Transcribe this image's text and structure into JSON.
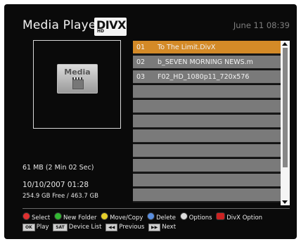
{
  "header": {
    "title": "Media Player",
    "logo_text": "DIVX",
    "logo_sub": "HD",
    "datetime": "June 11 08:39"
  },
  "preview": {
    "icon_label": "Media"
  },
  "info": {
    "size": "61 MB (2 Min 02 Sec)",
    "date": "10/10/2007 01:28",
    "storage": "254.9 GB Free / 463.7 GB"
  },
  "files": [
    {
      "num": "01",
      "name": "To The Limit.DivX"
    },
    {
      "num": "02",
      "name": "b_SEVEN MORNING NEWS.m"
    },
    {
      "num": "03",
      "name": "F02_HD_1080p11_720x576"
    },
    {
      "num": "",
      "name": ""
    },
    {
      "num": "",
      "name": ""
    },
    {
      "num": "",
      "name": ""
    },
    {
      "num": "",
      "name": ""
    },
    {
      "num": "",
      "name": ""
    },
    {
      "num": "",
      "name": ""
    },
    {
      "num": "",
      "name": ""
    },
    {
      "num": "",
      "name": ""
    }
  ],
  "legend": {
    "red": {
      "label": "Select",
      "color": "#e03030"
    },
    "green": {
      "label": "New Folder",
      "color": "#33b833"
    },
    "yellow": {
      "label": "Move/Copy",
      "color": "#e6cf2a"
    },
    "blue": {
      "label": "Delete",
      "color": "#5a8fe0"
    },
    "white": {
      "label": "Options",
      "color": "#dddddd"
    },
    "divx": {
      "label": "DivX Option",
      "color": "#cc2222"
    },
    "ok": {
      "key": "OK",
      "label": "Play"
    },
    "sat": {
      "key": "SAT",
      "label": "Device List"
    },
    "prev": {
      "key": "◀◀",
      "label": "Previous"
    },
    "next": {
      "key": "▶▶",
      "label": "Next"
    }
  }
}
